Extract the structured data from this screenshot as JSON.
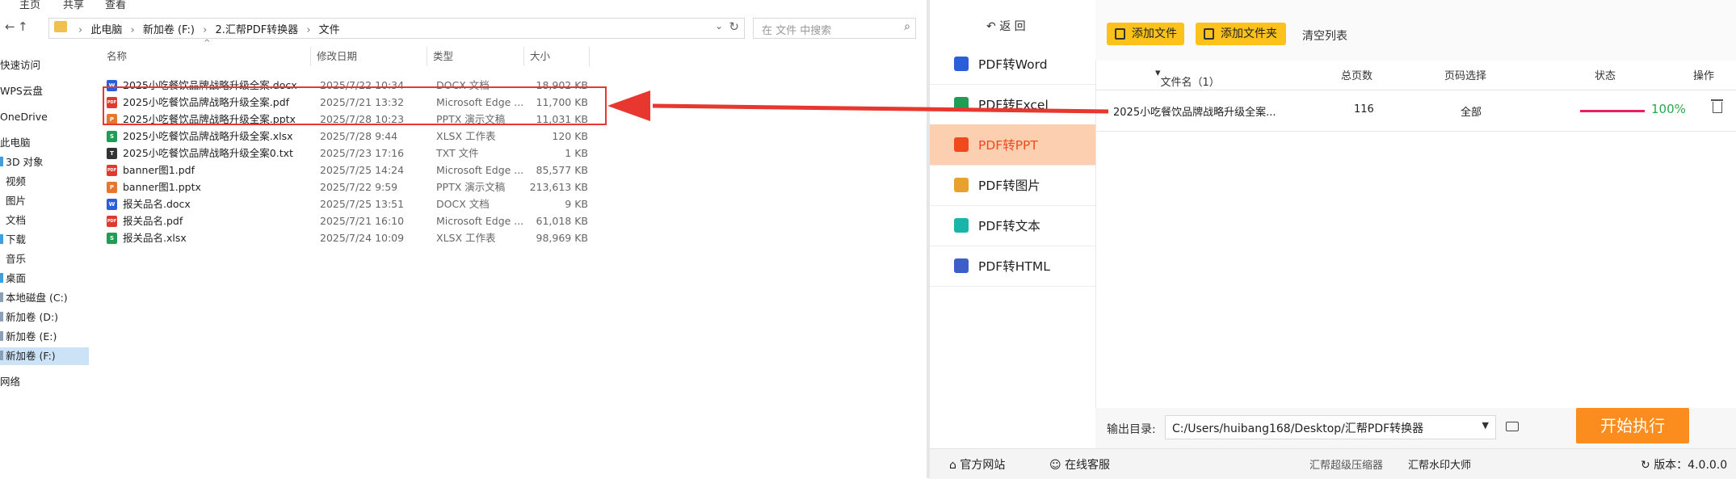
{
  "explorer": {
    "ribbon": {
      "tab_home": "主页",
      "tab_share": "共享",
      "tab_view": "查看"
    },
    "breadcrumb": [
      "此电脑",
      "新加卷 (F:)",
      "2.汇帮PDF转换器",
      "文件"
    ],
    "search_placeholder": "在 文件 中搜索",
    "sidebar": [
      {
        "label": "快速访问"
      },
      {
        "label": "WPS云盘"
      },
      {
        "label": "OneDrive"
      },
      {
        "label": "此电脑"
      },
      {
        "label": "3D 对象"
      },
      {
        "label": "视频"
      },
      {
        "label": "图片"
      },
      {
        "label": "文档"
      },
      {
        "label": "下载"
      },
      {
        "label": "音乐"
      },
      {
        "label": "桌面"
      },
      {
        "label": "本地磁盘 (C:)"
      },
      {
        "label": "新加卷 (D:)"
      },
      {
        "label": "新加卷 (E:)"
      },
      {
        "label": "新加卷 (F:)"
      },
      {
        "label": "网络"
      }
    ],
    "columns": {
      "name": "名称",
      "date": "修改日期",
      "type": "类型",
      "size": "大小"
    },
    "files": [
      {
        "name": "2025小吃餐饮品牌战略升级全案.docx",
        "date": "2025/7/22 10:34",
        "type": "DOCX 文档",
        "size": "18,902 KB",
        "icon": "W"
      },
      {
        "name": "2025小吃餐饮品牌战略升级全案.pdf",
        "date": "2025/7/21 13:32",
        "type": "Microsoft Edge ...",
        "size": "11,700 KB",
        "icon": "PDF"
      },
      {
        "name": "2025小吃餐饮品牌战略升级全案.pptx",
        "date": "2025/7/28 10:23",
        "type": "PPTX 演示文稿",
        "size": "11,031 KB",
        "icon": "P"
      },
      {
        "name": "2025小吃餐饮品牌战略升级全案.xlsx",
        "date": "2025/7/28 9:44",
        "type": "XLSX 工作表",
        "size": "120 KB",
        "icon": "S"
      },
      {
        "name": "2025小吃餐饮品牌战略升级全案0.txt",
        "date": "2025/7/23 17:16",
        "type": "TXT 文件",
        "size": "1 KB",
        "icon": "T"
      },
      {
        "name": "banner图1.pdf",
        "date": "2025/7/25 14:24",
        "type": "Microsoft Edge ...",
        "size": "85,577 KB",
        "icon": "PDF"
      },
      {
        "name": "banner图1.pptx",
        "date": "2025/7/22 9:59",
        "type": "PPTX 演示文稿",
        "size": "213,613 KB",
        "icon": "P"
      },
      {
        "name": "报关品名.docx",
        "date": "2025/7/25 13:51",
        "type": "DOCX 文档",
        "size": "9 KB",
        "icon": "W"
      },
      {
        "name": "报关品名.pdf",
        "date": "2025/7/21 16:10",
        "type": "Microsoft Edge ...",
        "size": "61,018 KB",
        "icon": "PDF"
      },
      {
        "name": "报关品名.xlsx",
        "date": "2025/7/24 10:09",
        "type": "XLSX 工作表",
        "size": "98,969 KB",
        "icon": "S"
      }
    ],
    "icon_colors": {
      "W": "#2b5fd9",
      "PDF": "#e03a2f",
      "P": "#e8772e",
      "S": "#1f9d55",
      "T": "#333333"
    }
  },
  "app": {
    "back_label": "返 回",
    "nav": [
      {
        "label": "PDF转Word",
        "color": "#2b5fd9"
      },
      {
        "label": "PDF转Excel",
        "color": "#1f9d55"
      },
      {
        "label": "PDF转PPT",
        "color": "#f04a1c"
      },
      {
        "label": "PDF转图片",
        "color": "#e8a02e"
      },
      {
        "label": "PDF转文本",
        "color": "#18b5a8"
      },
      {
        "label": "PDF转HTML",
        "color": "#3b5ec9"
      }
    ],
    "active_nav": 2,
    "toolbar": {
      "add_file": "添加文件",
      "add_folder": "添加文件夹",
      "clear_list": "清空列表"
    },
    "table": {
      "headers": {
        "filename": "文件名（1）",
        "pages": "总页数",
        "page_sel": "页码选择",
        "status": "状态",
        "action": "操作"
      },
      "row": {
        "filename": "2025小吃餐饮品牌战略升级全案...",
        "pages": "116",
        "page_sel": "全部",
        "progress": "100%",
        "progress_value": 1.0
      }
    },
    "output": {
      "label": "输出目录:",
      "path": "C:/Users/huibang168/Desktop/汇帮PDF转换器"
    },
    "start_button": "开始执行",
    "status_bar": {
      "website": "官方网站",
      "service": "在线客服",
      "compressor": "汇帮超级压缩器",
      "watermark": "汇帮水印大师",
      "version": "版本：4.0.0.0"
    },
    "accent": "#fb8c1e",
    "button_yellow": "#fcc21b"
  }
}
